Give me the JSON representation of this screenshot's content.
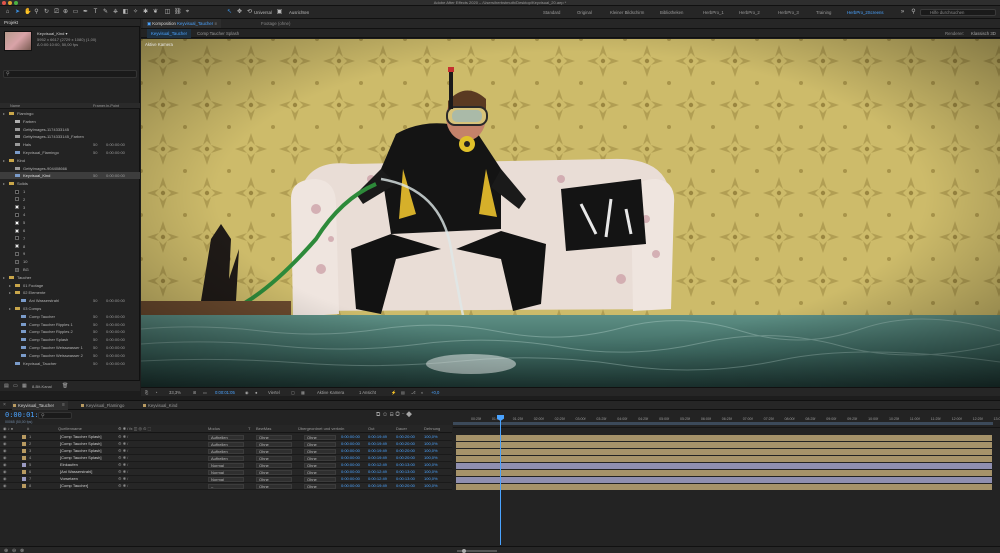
{
  "app": {
    "title": "Adobe After Effects 2020 – /Users/herbstmuth/Desktop/Keyvisual_20.aep *",
    "toolbar": {
      "universal_label": "Universal",
      "workspaces": [
        "Standard",
        "Original",
        "Kleiner Bildschirm",
        "Bibliotheken",
        "HerbPro_1",
        "HerbPro_2",
        "HerbPro_3",
        "Training",
        "HerbPro_2Screens"
      ],
      "active_workspace": "HerbPro_2Screens",
      "help_placeholder": "Hilfe durchsuchen"
    }
  },
  "project": {
    "tab_label": "Projekt",
    "selected_item": {
      "name": "Keyvisual_Kind ▾",
      "line1": "5952 x 6617 (2729 x 1080) (1,00)",
      "line2": "∆ 0:00:10:00, 50,00 fps"
    },
    "columns": {
      "name": "Name",
      "fps": "Framer.",
      "in": "In-Point"
    },
    "rows": [
      {
        "indent": 0,
        "type": "folder",
        "name": "Flamingo",
        "fps": "",
        "in": ""
      },
      {
        "indent": 1,
        "type": "solid",
        "name": "Farben",
        "fps": "",
        "in": ""
      },
      {
        "indent": 1,
        "type": "footage",
        "name": "GettyImages-1174333145",
        "fps": "",
        "in": ""
      },
      {
        "indent": 1,
        "type": "footage",
        "name": "GettyImages-1174333145_Farben",
        "fps": "",
        "in": ""
      },
      {
        "indent": 1,
        "type": "footage",
        "name": "Hals",
        "fps": "50",
        "in": "0:00:00:00"
      },
      {
        "indent": 1,
        "type": "comp",
        "name": "Keyvisual_Flamingo",
        "fps": "50",
        "in": "0:00:00:00"
      },
      {
        "indent": 0,
        "type": "folder",
        "name": "Kind",
        "fps": "",
        "in": ""
      },
      {
        "indent": 1,
        "type": "footage",
        "name": "GettyImages-904408666",
        "fps": "",
        "in": ""
      },
      {
        "indent": 1,
        "type": "comp",
        "name": "Keyvisual_Kind",
        "fps": "50",
        "in": "0:00:00:00",
        "selected": true
      },
      {
        "indent": 0,
        "type": "folder",
        "name": "Solids",
        "fps": "",
        "in": ""
      },
      {
        "indent": 1,
        "type": "swatch",
        "name": "1",
        "swatch": "#111111"
      },
      {
        "indent": 1,
        "type": "swatch",
        "name": "2",
        "swatch": "#202020"
      },
      {
        "indent": 1,
        "type": "swatch",
        "name": "3",
        "swatch": "#f2f2f2"
      },
      {
        "indent": 1,
        "type": "swatch",
        "name": "4",
        "swatch": "#141414"
      },
      {
        "indent": 1,
        "type": "swatch",
        "name": "5",
        "swatch": "#ffffff"
      },
      {
        "indent": 1,
        "type": "swatch",
        "name": "6",
        "swatch": "#ededed"
      },
      {
        "indent": 1,
        "type": "swatch",
        "name": "7",
        "swatch": "#1a1a1a"
      },
      {
        "indent": 1,
        "type": "swatch",
        "name": "8",
        "swatch": "#e6e6e6"
      },
      {
        "indent": 1,
        "type": "swatch",
        "name": "9",
        "swatch": "#222222"
      },
      {
        "indent": 1,
        "type": "swatch",
        "name": "10",
        "swatch": "#2b2b2b"
      },
      {
        "indent": 1,
        "type": "swatch",
        "name": "BG",
        "swatch": "#4a4a4a"
      },
      {
        "indent": 0,
        "type": "folder",
        "name": "Taucher",
        "fps": "",
        "in": ""
      },
      {
        "indent": 1,
        "type": "folder",
        "name": "01 Footage",
        "fps": "",
        "in": ""
      },
      {
        "indent": 1,
        "type": "folder",
        "name": "02 Elemente",
        "fps": "",
        "in": ""
      },
      {
        "indent": 2,
        "type": "comp",
        "name": "Ani Wasserstrahl",
        "fps": "50",
        "in": "0:00:00:00"
      },
      {
        "indent": 1,
        "type": "folder",
        "name": "03 Comps",
        "fps": "",
        "in": ""
      },
      {
        "indent": 2,
        "type": "comp",
        "name": "Comp Taucher",
        "fps": "50",
        "in": "0:00:00:00"
      },
      {
        "indent": 2,
        "type": "comp",
        "name": "Comp Taucher Ripples 1",
        "fps": "50",
        "in": "0:00:00:00"
      },
      {
        "indent": 2,
        "type": "comp",
        "name": "Comp Taucher Ripples 2",
        "fps": "50",
        "in": "0:00:00:00"
      },
      {
        "indent": 2,
        "type": "comp",
        "name": "Comp Taucher Splash",
        "fps": "50",
        "in": "0:00:00:00"
      },
      {
        "indent": 2,
        "type": "comp",
        "name": "Comp Taucher Weisswasser 1",
        "fps": "50",
        "in": "0:00:00:00"
      },
      {
        "indent": 2,
        "type": "comp",
        "name": "Comp Taucher Weisswasser 2",
        "fps": "50",
        "in": "0:00:00:00"
      },
      {
        "indent": 1,
        "type": "comp",
        "name": "Keyvisual_Taucher",
        "fps": "50",
        "in": "0:00:00:00"
      }
    ],
    "bpc": "8-Bit-Kanal"
  },
  "viewer": {
    "tab_prefix": "Komposition",
    "tab_comp": "Keyvisual_Taucher",
    "footage_tab": "Footage (ohne)",
    "guides_label": "Ausrichten",
    "sub_tabs": [
      "Keyvisual_Taucher",
      "Comp Taucher Splash"
    ],
    "renderer_label": "Renderer:",
    "renderer_value": "Klassisch 3D",
    "overlay_label": "Aktive Kamera",
    "controls": {
      "zoom": "33,3%",
      "timecode": "0:00:01:05",
      "resolution": "Viertel",
      "camera": "Aktive Kamera",
      "views": "1 Ansicht",
      "exposure": "+0,0"
    }
  },
  "timeline": {
    "tabs": [
      {
        "label": "Keyvisual_Taucher",
        "color": "#b89a61",
        "active": true
      },
      {
        "label": "Keyvisual_Flamingo",
        "color": "#b89a61",
        "active": false
      },
      {
        "label": "Keyvisual_Kind",
        "color": "#b89a61",
        "active": false
      }
    ],
    "timecode": "0:00:01:05",
    "fps_note": "00065 (50,00 fps)",
    "columns": {
      "name": "Quellenname",
      "mode": "Modus",
      "t": "T",
      "trkmat": "BewMas",
      "parent": "Übergeordnet und verkn.",
      "in": "In",
      "out": "Out",
      "duration": "Dauer",
      "stretch": "Dehnung"
    },
    "layers": [
      {
        "num": "1",
        "name": "[Comp Taucher Splash]",
        "mode": "Aufhellen",
        "trk": "Ohne",
        "parent": "Ohne",
        "in": "0:00:00:00",
        "out": "0:00:19:49",
        "dur": "0:00:20:00",
        "str": "100,0%",
        "label": "#b89a61"
      },
      {
        "num": "2",
        "name": "[Comp Taucher Splash]",
        "mode": "Aufhellen",
        "trk": "Ohne",
        "parent": "Ohne",
        "in": "0:00:00:00",
        "out": "0:00:19:49",
        "dur": "0:00:20:00",
        "str": "100,0%",
        "label": "#b89a61"
      },
      {
        "num": "3",
        "name": "[Comp Taucher Splash]",
        "mode": "Aufhellen",
        "trk": "Ohne",
        "parent": "Ohne",
        "in": "0:00:00:00",
        "out": "0:00:19:49",
        "dur": "0:00:20:00",
        "str": "100,0%",
        "label": "#b89a61"
      },
      {
        "num": "4",
        "name": "[Comp Taucher Splash]",
        "mode": "Aufhellen",
        "trk": "Ohne",
        "parent": "Ohne",
        "in": "0:00:00:00",
        "out": "0:00:19:49",
        "dur": "0:00:20:00",
        "str": "100,0%",
        "label": "#b89a61"
      },
      {
        "num": "5",
        "name": "Einkaufen",
        "mode": "Normal",
        "trk": "Ohne",
        "parent": "Ohne",
        "in": "0:00:00:00",
        "out": "0:00:12:49",
        "dur": "0:00:13:00",
        "str": "100,0%",
        "label": "#9a9ac2"
      },
      {
        "num": "6",
        "name": "[Ani Wasserstrahl]",
        "mode": "Normal",
        "trk": "Ohne",
        "parent": "Ohne",
        "in": "0:00:00:00",
        "out": "0:00:12:49",
        "dur": "0:00:13:00",
        "str": "100,0%",
        "label": "#b89a61"
      },
      {
        "num": "7",
        "name": "Vorsetzen",
        "mode": "Normal",
        "trk": "Ohne",
        "parent": "Ohne",
        "in": "0:00:00:00",
        "out": "0:00:12:49",
        "dur": "0:00:13:00",
        "str": "100,0%",
        "label": "#9a9ac2"
      },
      {
        "num": "8",
        "name": "[Comp Taucher]",
        "mode": "–",
        "trk": "Ohne",
        "parent": "Ohne",
        "in": "0:00:00:00",
        "out": "0:00:19:49",
        "dur": "0:00:20:00",
        "str": "100,0%",
        "label": "#b89a61"
      }
    ],
    "ruler": [
      "00:25f",
      "01:00f",
      "01:25f",
      "02:00f",
      "02:25f",
      "03:00f",
      "03:25f",
      "04:00f",
      "04:25f",
      "05:00f",
      "05:25f",
      "06:00f",
      "06:25f",
      "07:00f",
      "07:25f",
      "08:00f",
      "08:25f",
      "09:00f",
      "09:25f",
      "10:00f",
      "10:25f",
      "11:00f",
      "11:25f",
      "12:00f",
      "12:25f",
      "13:0"
    ],
    "bar_colors": {
      "comp": "#a6936a",
      "solid": "#8f8fb0"
    },
    "bars": [
      {
        "type": "comp",
        "start": 0,
        "end": 1
      },
      {
        "type": "comp",
        "start": 0,
        "end": 1
      },
      {
        "type": "comp",
        "start": 0,
        "end": 1
      },
      {
        "type": "comp",
        "start": 0,
        "end": 1
      },
      {
        "type": "solid",
        "start": 0,
        "end": 1
      },
      {
        "type": "comp",
        "start": 0,
        "end": 1
      },
      {
        "type": "solid",
        "start": 0,
        "end": 1
      },
      {
        "type": "comp",
        "start": 0,
        "end": 1
      }
    ]
  },
  "colors": {
    "accent": "#4aa3ff",
    "panel": "#232323",
    "wallpaper": "#cbb966",
    "water": "#3f6b63"
  }
}
